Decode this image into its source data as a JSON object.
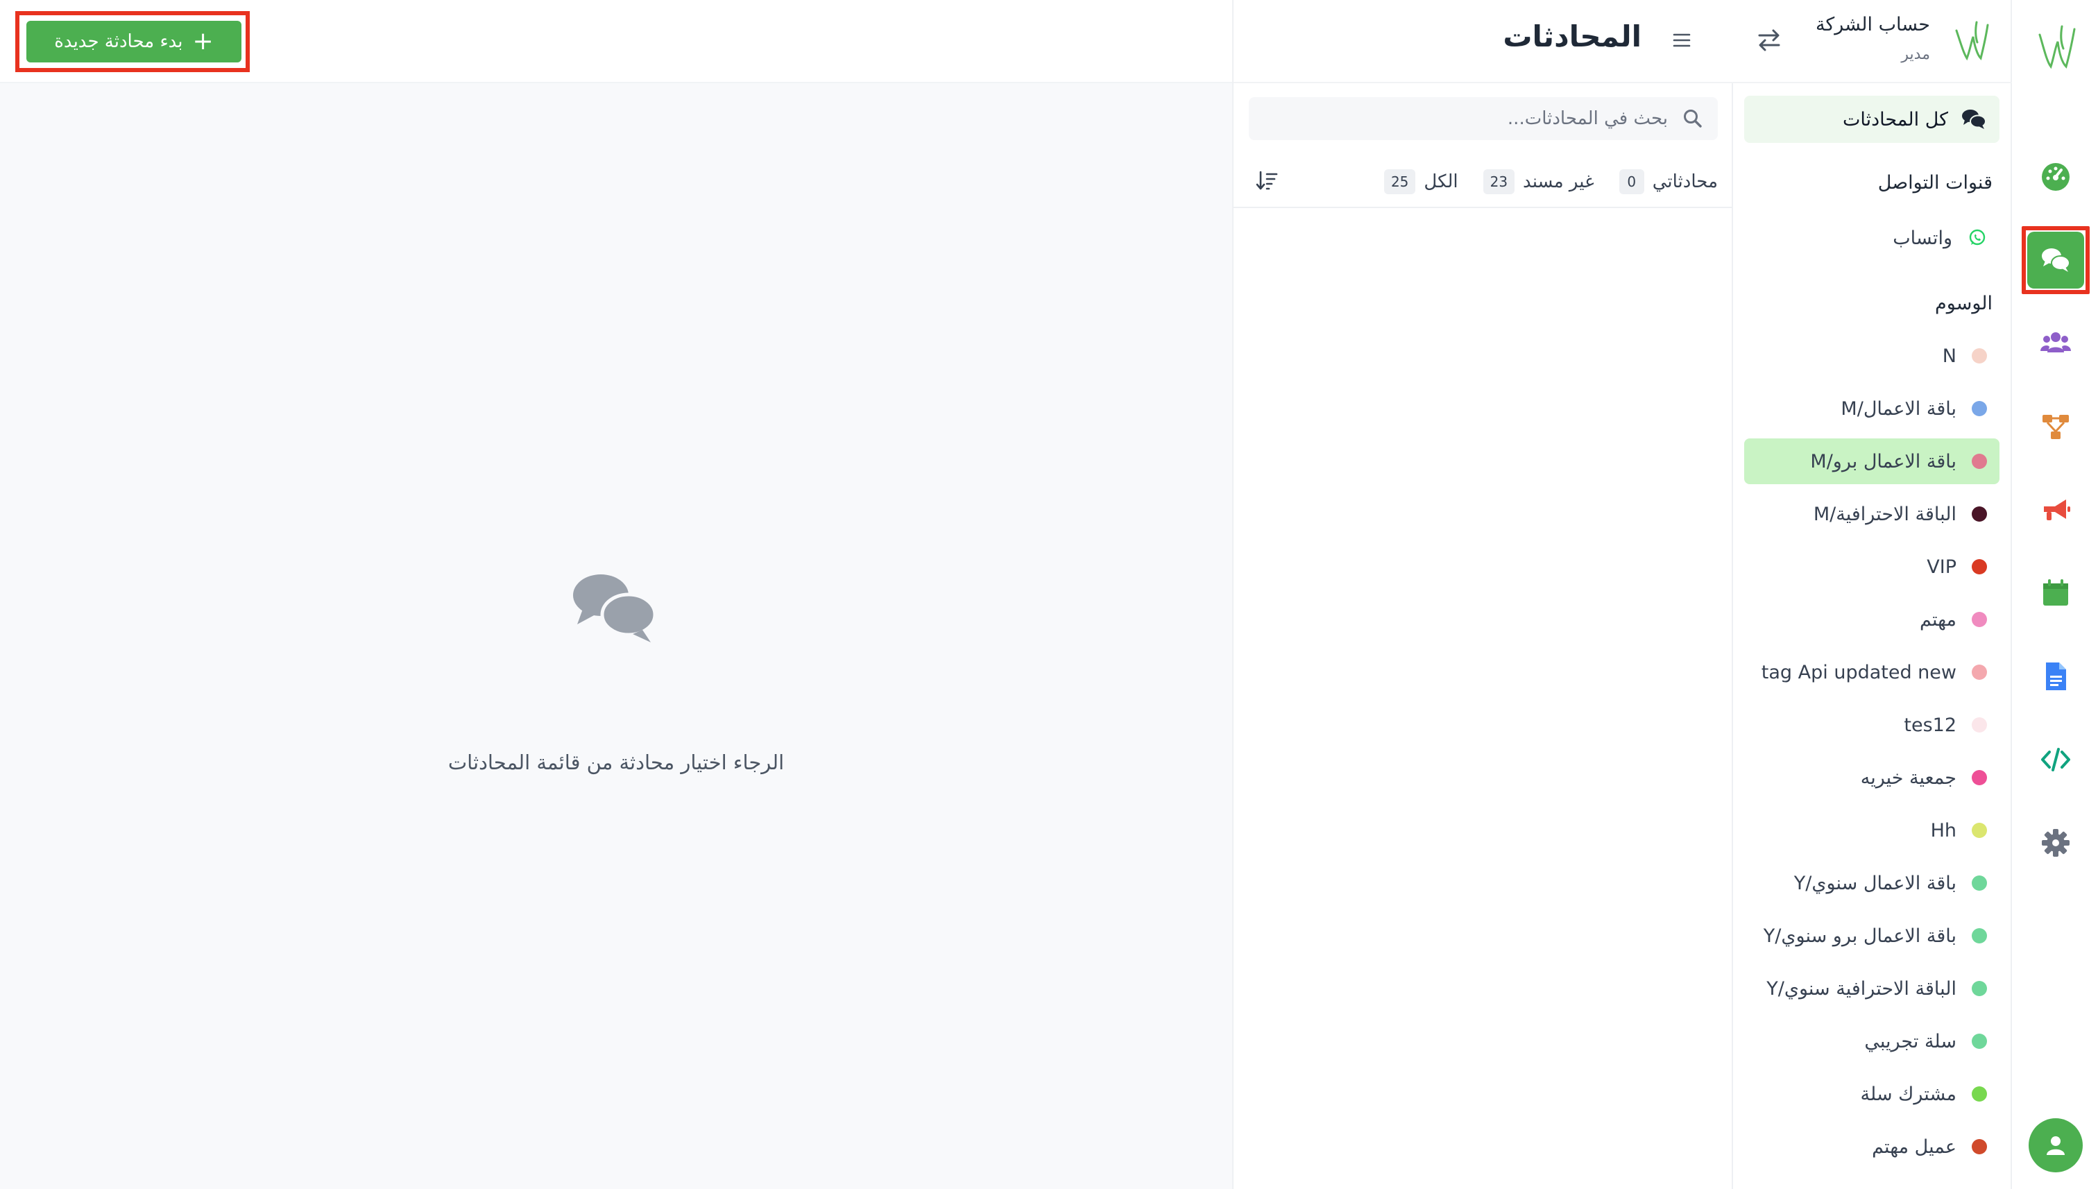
{
  "rail": {
    "items": [
      {
        "name": "dashboard-icon",
        "color": "#4caf50"
      },
      {
        "name": "conversations-icon",
        "color": "#ffffff",
        "active": true
      },
      {
        "name": "contacts-icon",
        "color": "#8e5ec9"
      },
      {
        "name": "flows-icon",
        "color": "#e08a3c"
      },
      {
        "name": "campaigns-icon",
        "color": "#e84c3d"
      },
      {
        "name": "calendar-icon",
        "color": "#4caf50"
      },
      {
        "name": "document-icon",
        "color": "#3b82f6"
      },
      {
        "name": "code-icon",
        "color": "#10a37f"
      },
      {
        "name": "settings-icon",
        "color": "#6b7280"
      }
    ]
  },
  "account": {
    "name": "حساب الشركة",
    "role": "مدير"
  },
  "sidebar": {
    "all_conversations": "كل المحادثات",
    "channels_title": "قنوات التواصل",
    "channels": [
      {
        "label": "واتساب",
        "icon": "whatsapp-icon"
      }
    ],
    "tags_title": "الوسوم",
    "tags": [
      {
        "label": "N",
        "color": "#f6d3c8"
      },
      {
        "label": "باقة الاعمال/M",
        "color": "#7aa7e8"
      },
      {
        "label": "باقة الاعمال برو/M",
        "color": "#e07a8f",
        "active": true
      },
      {
        "label": "الباقة الاحترافية/M",
        "color": "#4a1527"
      },
      {
        "label": "VIP",
        "color": "#d93a23"
      },
      {
        "label": "مهتم",
        "color": "#f08bbf"
      },
      {
        "label": "tag Api updated new",
        "color": "#f4a8ae"
      },
      {
        "label": "tes12",
        "color": "#fbe6ea"
      },
      {
        "label": "جمعية خيريه",
        "color": "#ee4f96"
      },
      {
        "label": "Hh",
        "color": "#dbe66f"
      },
      {
        "label": "باقة الاعمال سنوي/Y",
        "color": "#6fd79a"
      },
      {
        "label": "باقة الاعمال برو سنوي/Y",
        "color": "#6fd79a"
      },
      {
        "label": "الباقة الاحترافية سنوي/Y",
        "color": "#6fd79a"
      },
      {
        "label": "سلة تجريبي",
        "color": "#6fd79a"
      },
      {
        "label": "مشترك سلة",
        "color": "#78d84f"
      },
      {
        "label": "عميل مهتم",
        "color": "#d04a2b"
      }
    ]
  },
  "conversations": {
    "title": "المحادثات",
    "search_placeholder": "بحث في المحادثات...",
    "filters": [
      {
        "label": "محادثاتي",
        "count": "0"
      },
      {
        "label": "غير مسند",
        "count": "23"
      },
      {
        "label": "الكل",
        "count": "25"
      }
    ]
  },
  "main": {
    "new_conversation_label": "بدء محادثة جديدة",
    "empty_message": "الرجاء اختيار محادثة من قائمة المحادثات"
  },
  "colors": {
    "accent": "#4caf50",
    "highlight": "#e8321f",
    "active_tag_bg": "#c9f3c4"
  }
}
